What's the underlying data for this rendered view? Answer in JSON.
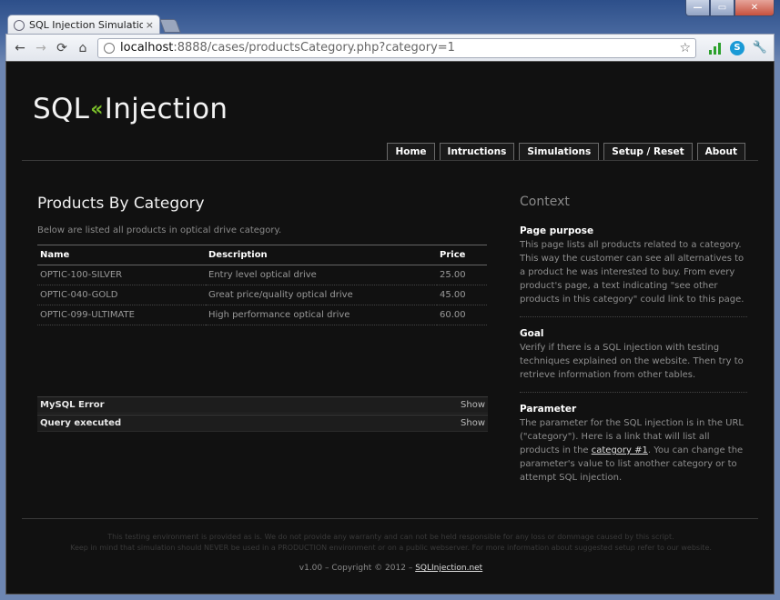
{
  "browser": {
    "tab_title": "SQL Injection Simulation En",
    "tab_close": "×",
    "url_host": "localhost",
    "url_path": ":8888/cases/productsCategory.php?category=1",
    "back_icon": "←",
    "forward_icon": "→",
    "reload_icon": "⟳",
    "home_icon": "⌂",
    "star_icon": "☆",
    "wrench_icon": "🔧",
    "skype_letter": "S",
    "win_min": "—",
    "win_max": "▭",
    "win_close": "✕"
  },
  "site": {
    "logo_left": "SQL",
    "logo_accent": "«",
    "logo_right": "Injection",
    "nav": [
      "Home",
      "Intructions",
      "Simulations",
      "Setup / Reset",
      "About"
    ]
  },
  "main": {
    "title": "Products By Category",
    "intro": "Below are listed all products in optical drive category.",
    "columns": [
      "Name",
      "Description",
      "Price"
    ],
    "rows": [
      [
        "OPTIC-100-SILVER",
        "Entry level optical drive",
        "25.00"
      ],
      [
        "OPTIC-040-GOLD",
        "Great price/quality optical drive",
        "45.00"
      ],
      [
        "OPTIC-099-ULTIMATE",
        "High performance optical drive",
        "60.00"
      ]
    ],
    "debug": [
      {
        "label": "MySQL Error",
        "toggle": "Show"
      },
      {
        "label": "Query executed",
        "toggle": "Show"
      }
    ]
  },
  "context": {
    "title": "Context",
    "purpose_heading": "Page purpose",
    "purpose_text": "This page lists all products related to a category. This way the customer can see all alternatives to a product he was interested to buy. From every product's page, a text indicating \"see other products in this category\" could link to this page.",
    "goal_heading": "Goal",
    "goal_text": "Verify if there is a SQL injection with testing techniques explained on the website. Then try to retrieve information from other tables.",
    "param_heading": "Parameter",
    "param_text_before": "The parameter for the SQL injection is in the URL (\"category\"). Here is a link that will list all products in the ",
    "param_link": "category #1",
    "param_text_after": ". You can change the parameter's value to list another category or to attempt SQL injection."
  },
  "footer": {
    "disclaimer_line1": "This testing environment is provided as is. We do not provide any warranty and can not be held responsible for any loss or dommage caused by this script.",
    "disclaimer_line2": "Keep in mind that simulation should NEVER be used in a PRODUCTION environment or on a public webserver. For more information about suggested setup refer to our website.",
    "copyright": "v1.00 – Copyright © 2012 – ",
    "copyright_link": "SQLInjection.net"
  }
}
